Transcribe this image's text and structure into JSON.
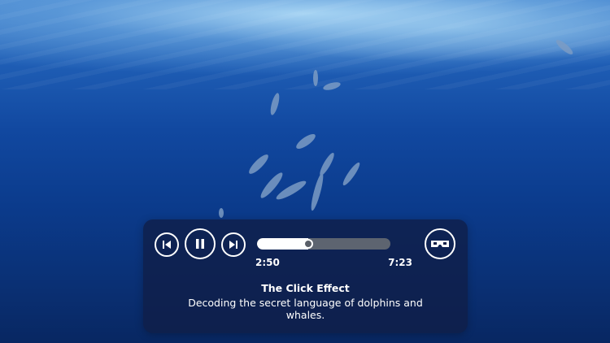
{
  "player": {
    "title": "The Click Effect",
    "description": "Decoding the secret language of dolphins and whales.",
    "current_time": "2:50",
    "total_time": "7:23",
    "progress": 0.384,
    "controls": {
      "previous": "skip-previous-icon",
      "pause": "pause-icon",
      "next": "skip-next-icon",
      "vr": "vr-headset-icon"
    }
  },
  "colors": {
    "panel": "#0f1e46",
    "track": "#5d6470",
    "progress": "#ffffff"
  }
}
